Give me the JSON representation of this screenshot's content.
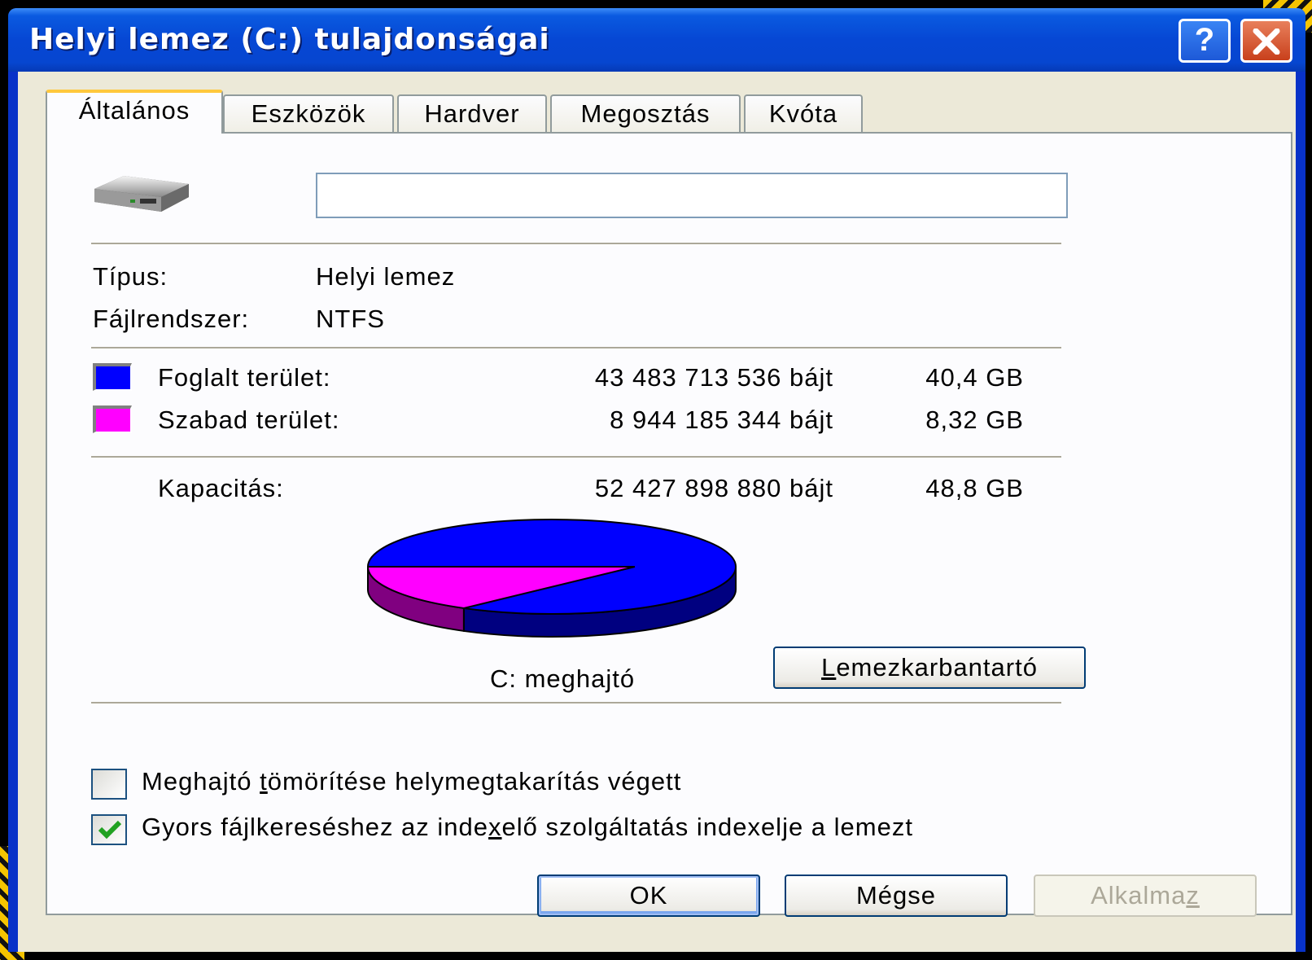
{
  "window": {
    "title": "Helyi lemez (C:) tulajdonságai",
    "help_label": "?",
    "close_icon": "close-icon"
  },
  "tabs": [
    {
      "label": "Általános",
      "active": true
    },
    {
      "label": "Eszközök",
      "active": false
    },
    {
      "label": "Hardver",
      "active": false
    },
    {
      "label": "Megosztás",
      "active": false
    },
    {
      "label": "Kvóta",
      "active": false
    }
  ],
  "general": {
    "drive_icon": "hard-drive-icon",
    "volume_name": "",
    "type_label": "Típus:",
    "type_value": "Helyi lemez",
    "fs_label": "Fájlrendszer:",
    "fs_value": "NTFS",
    "used": {
      "label": "Foglalt terület:",
      "bytes": "43 483 713 536 bájt",
      "size": "40,4 GB",
      "color": "#0000ff"
    },
    "free": {
      "label": "Szabad terület:",
      "bytes": "8 944 185 344 bájt",
      "size": "8,32 GB",
      "color": "#ff00ff"
    },
    "capacity": {
      "label": "Kapacitás:",
      "bytes": "52 427 898 880 bájt",
      "size": "48,8 GB"
    },
    "drive_caption": "C: meghajtó",
    "cleanup_button": {
      "underlined": "L",
      "rest": "emezkarbantartó"
    },
    "compress": {
      "pre": "Meghajtó ",
      "underlined": "t",
      "post": "ömörítése helymegtakarítás végett",
      "checked": false
    },
    "index": {
      "pre": "Gyors fájlkereséshez az inde",
      "underlined": "x",
      "post": "elő szolgáltatás indexelje a lemezt",
      "checked": true
    }
  },
  "chart_data": {
    "type": "pie",
    "categories": [
      "Foglalt terület",
      "Szabad terület"
    ],
    "values": [
      43483713536,
      8944185344
    ],
    "colors": [
      "#0000ff",
      "#ff00ff"
    ],
    "side_colors": [
      "#000080",
      "#800080"
    ],
    "title": "C: meghajtó"
  },
  "buttons": {
    "ok": "OK",
    "cancel": "Mégse",
    "apply": {
      "pre": "Alkalma",
      "underlined": "z"
    }
  }
}
